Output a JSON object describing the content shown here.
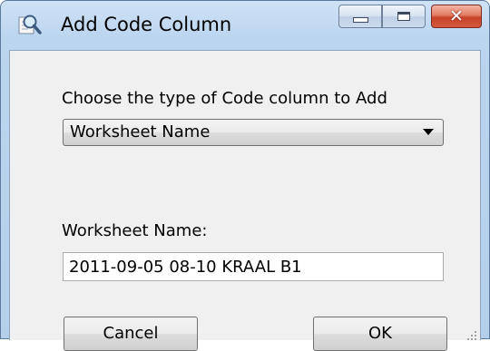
{
  "window": {
    "title": "Add Code Column",
    "icon": "magnifier-app-icon",
    "caption_buttons": [
      "minimize",
      "maximize",
      "close"
    ]
  },
  "form": {
    "type_prompt": "Choose the type of Code column to Add",
    "type_selected": "Worksheet Name",
    "field_label": "Worksheet Name:",
    "field_value": "2011-09-05 08-10 KRAAL B1"
  },
  "buttons": {
    "cancel_label": "Cancel",
    "ok_label": "OK"
  },
  "colors": {
    "frame": "#bcd5ef",
    "client": "#f0f0f0",
    "close_button": "#c8432a"
  }
}
